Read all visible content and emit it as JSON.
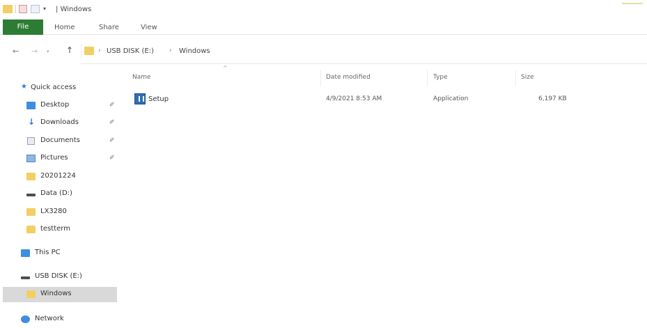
{
  "title_bar": {
    "quick_access_dropdown": "▾",
    "path_separator": "|",
    "title": "Windows"
  },
  "ribbon": {
    "tabs": [
      "File",
      "Home",
      "Share",
      "View"
    ]
  },
  "address_bar": {
    "back": "←",
    "forward": "→",
    "recent_dropdown": "▾",
    "up": "↑",
    "breadcrumbs": [
      "USB DISK (E:)",
      "Windows"
    ],
    "separator": "›"
  },
  "sidebar": {
    "items": [
      {
        "label": "Quick access",
        "icon": "star-icon",
        "pinned": false
      },
      {
        "label": "Desktop",
        "icon": "desktop-icon",
        "pinned": true
      },
      {
        "label": "Downloads",
        "icon": "download-icon",
        "pinned": true
      },
      {
        "label": "Documents",
        "icon": "documents-icon",
        "pinned": true
      },
      {
        "label": "Pictures",
        "icon": "pictures-icon",
        "pinned": true
      },
      {
        "label": "20201224",
        "icon": "folder-icon",
        "pinned": false
      },
      {
        "label": "Data (D:)",
        "icon": "drive-icon",
        "pinned": false
      },
      {
        "label": "LX3280",
        "icon": "folder-icon",
        "pinned": false
      },
      {
        "label": "testterm",
        "icon": "folder-icon",
        "pinned": false
      },
      {
        "label": "This PC",
        "icon": "pc-icon",
        "pinned": false
      },
      {
        "label": "USB DISK (E:)",
        "icon": "drive-icon",
        "pinned": false
      },
      {
        "label": "Windows",
        "icon": "folder-icon",
        "pinned": false,
        "selected": true
      },
      {
        "label": "Network",
        "icon": "network-icon",
        "pinned": false
      }
    ],
    "pin_glyph": "✐"
  },
  "columns": {
    "name": "Name",
    "date_modified": "Date modified",
    "type": "Type",
    "size": "Size",
    "sort_indicator": "^"
  },
  "files": [
    {
      "name": "Setup",
      "date_modified": "4/9/2021 8:53 AM",
      "type": "Application",
      "size": "6,197 KB",
      "icon": "setup-app-icon"
    }
  ]
}
